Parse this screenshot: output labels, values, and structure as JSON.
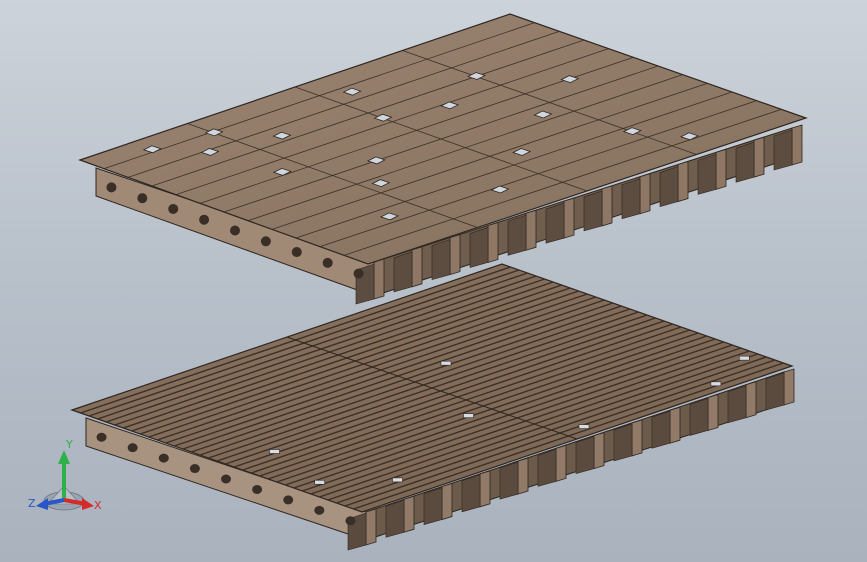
{
  "viewport": {
    "background_top": "#cdd3da",
    "background_bottom": "#a9b2bd"
  },
  "model": {
    "material_color": "#8f7a66",
    "edge_color": "#2e2620"
  },
  "triad": {
    "x_label": "X",
    "y_label": "Y",
    "z_label": "Z",
    "x_color": "#d42a2a",
    "y_color": "#2fb04a",
    "z_color": "#2a56c8"
  }
}
